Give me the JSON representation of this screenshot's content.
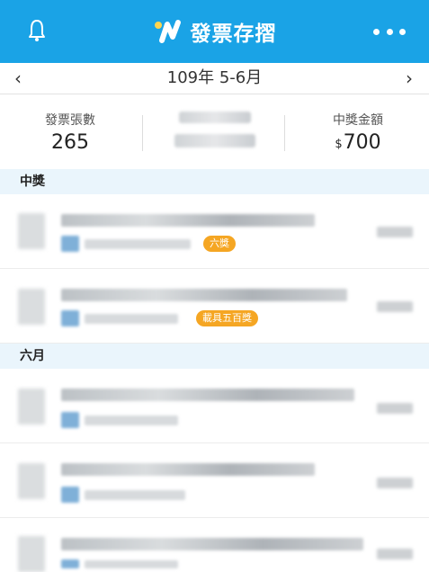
{
  "app": {
    "title": "發票存摺",
    "colors": {
      "header": "#1aa3e6",
      "section_bg": "#eaf5fc",
      "badge": "#f5a623"
    },
    "icons": {
      "left": "bell-icon",
      "brand": "app-logo",
      "right": "more-icon"
    }
  },
  "period": {
    "label": "109年 5-6月",
    "prev": "‹",
    "next": "›"
  },
  "summary": {
    "count_label": "發票張數",
    "count_value": "265",
    "prize_label": "中獎金額",
    "prize_currency": "$",
    "prize_value": "700"
  },
  "sections": [
    {
      "title": "中獎",
      "items": [
        {
          "badge": "六獎"
        },
        {
          "badge": "載具五百獎"
        }
      ]
    },
    {
      "title": "六月",
      "items": [
        {},
        {},
        {}
      ]
    }
  ]
}
